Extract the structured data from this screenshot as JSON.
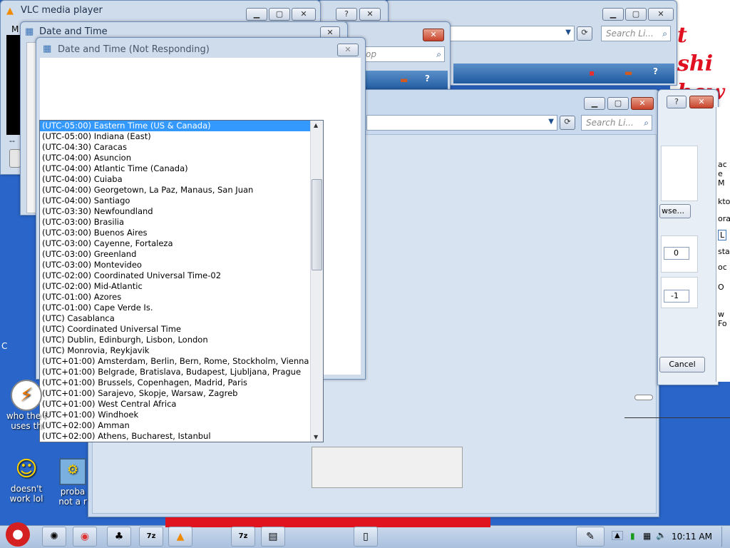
{
  "windows": {
    "vlc": {
      "title": "VLC media player",
      "menu_fragment": "M",
      "time_fragment": "--"
    },
    "dt_back": {
      "title": "Date and Time"
    },
    "dt_front": {
      "title": "Date and Time (Not Responding)"
    },
    "explorer_top": {
      "search_placeholder": "Search Li...",
      "search_fragment": "op"
    },
    "explorer_mid": {
      "search_placeholder": "Search Li...",
      "search_fragment": "op"
    },
    "explorer_main": {
      "search_placeholder": "Search Li..."
    },
    "props": {
      "browse_label": "wse...",
      "cancel_label": "Cancel",
      "spin1_value": "0",
      "spin2_value": "-1",
      "right_fragments": [
        "ac",
        "e M",
        "kto",
        "ora",
        "L",
        "sta",
        "oc",
        "O",
        "w Fo"
      ]
    }
  },
  "timezones": {
    "selected_index": 0,
    "items": [
      "(UTC-05:00) Eastern Time (US & Canada)",
      "(UTC-05:00) Indiana (East)",
      "(UTC-04:30) Caracas",
      "(UTC-04:00) Asuncion",
      "(UTC-04:00) Atlantic Time (Canada)",
      "(UTC-04:00) Cuiaba",
      "(UTC-04:00) Georgetown, La Paz, Manaus, San Juan",
      "(UTC-04:00) Santiago",
      "(UTC-03:30) Newfoundland",
      "(UTC-03:00) Brasilia",
      "(UTC-03:00) Buenos Aires",
      "(UTC-03:00) Cayenne, Fortaleza",
      "(UTC-03:00) Greenland",
      "(UTC-03:00) Montevideo",
      "(UTC-02:00) Coordinated Universal Time-02",
      "(UTC-02:00) Mid-Atlantic",
      "(UTC-01:00) Azores",
      "(UTC-01:00) Cape Verde Is.",
      "(UTC) Casablanca",
      "(UTC) Coordinated Universal Time",
      "(UTC) Dublin, Edinburgh, Lisbon, London",
      "(UTC) Monrovia, Reykjavik",
      "(UTC+01:00) Amsterdam, Berlin, Bern, Rome, Stockholm, Vienna",
      "(UTC+01:00) Belgrade, Bratislava, Budapest, Ljubljana, Prague",
      "(UTC+01:00) Brussels, Copenhagen, Madrid, Paris",
      "(UTC+01:00) Sarajevo, Skopje, Warsaw, Zagreb",
      "(UTC+01:00) West Central Africa",
      "(UTC+01:00) Windhoek",
      "(UTC+02:00) Amman",
      "(UTC+02:00) Athens, Bucharest, Istanbul"
    ]
  },
  "desktop": {
    "handwriting_line1": "t shi",
    "handwriting_line2": "hew",
    "icon1_label_line1": "who the f",
    "icon1_label_line2": "uses th",
    "icon2_label_line1": "doesn't",
    "icon2_label_line2": "work lol",
    "icon3_label_line1": "proba",
    "icon3_label_line2": "not a r",
    "edge_fragment": "C"
  },
  "taskbar": {
    "clock": "10:11 AM"
  },
  "colors": {
    "selection": "#3399ff",
    "taskbar_red": "#e0141e",
    "handwriting": "#e01020"
  }
}
